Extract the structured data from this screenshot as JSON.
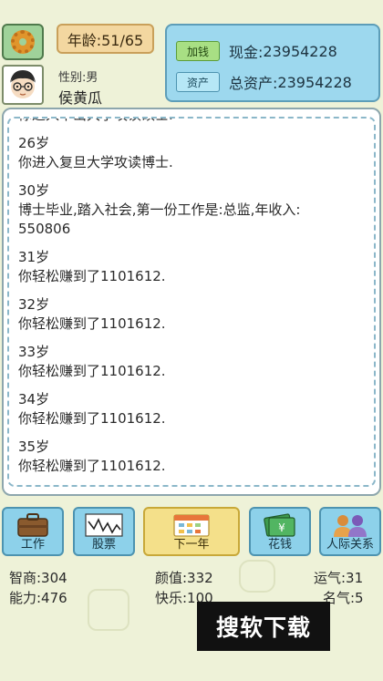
{
  "header": {
    "age_text": "年龄:51/65",
    "gender_text": "性别:男",
    "name": "侯黄瓜"
  },
  "money": {
    "add_button": "加钱",
    "assets_button": "资产",
    "cash_label": "现金:",
    "cash_value": "23954228",
    "total_label": "总资产:",
    "total_value": "23954228"
  },
  "log": {
    "entries": [
      {
        "year": "",
        "text": "你进入中山大学攻读硕士."
      },
      {
        "year": "26岁",
        "text": "你进入复旦大学攻读博士."
      },
      {
        "year": "30岁",
        "text": "博士毕业,踏入社会,第一份工作是:总监,年收入:",
        "text2": "550806"
      },
      {
        "year": "31岁",
        "text": "你轻松赚到了1101612."
      },
      {
        "year": "32岁",
        "text": "你轻松赚到了1101612."
      },
      {
        "year": "33岁",
        "text": "你轻松赚到了1101612."
      },
      {
        "year": "34岁",
        "text": "你轻松赚到了1101612."
      },
      {
        "year": "35岁",
        "text": "你轻松赚到了1101612."
      }
    ]
  },
  "actions": {
    "work": "工作",
    "stocks": "股票",
    "next_year": "下一年",
    "spend": "花钱",
    "relations": "人际关系"
  },
  "stats": {
    "iq": "智商:304",
    "looks": "颜值:332",
    "luck": "运气:31",
    "ability": "能力:476",
    "happiness": "快乐:100",
    "fame": "名气:5"
  },
  "watermark": "搜软下载",
  "icons": {
    "settings": "gear-icon",
    "work": "briefcase-icon",
    "stocks": "stock-chart-icon",
    "next_year": "calendar-icon",
    "spend": "money-icon",
    "relations": "people-icon"
  },
  "colors": {
    "background": "#eef2d8",
    "panel_blue": "#9dd8ee",
    "next_year_yellow": "#f4e08a",
    "age_box": "#f3d7a0"
  }
}
